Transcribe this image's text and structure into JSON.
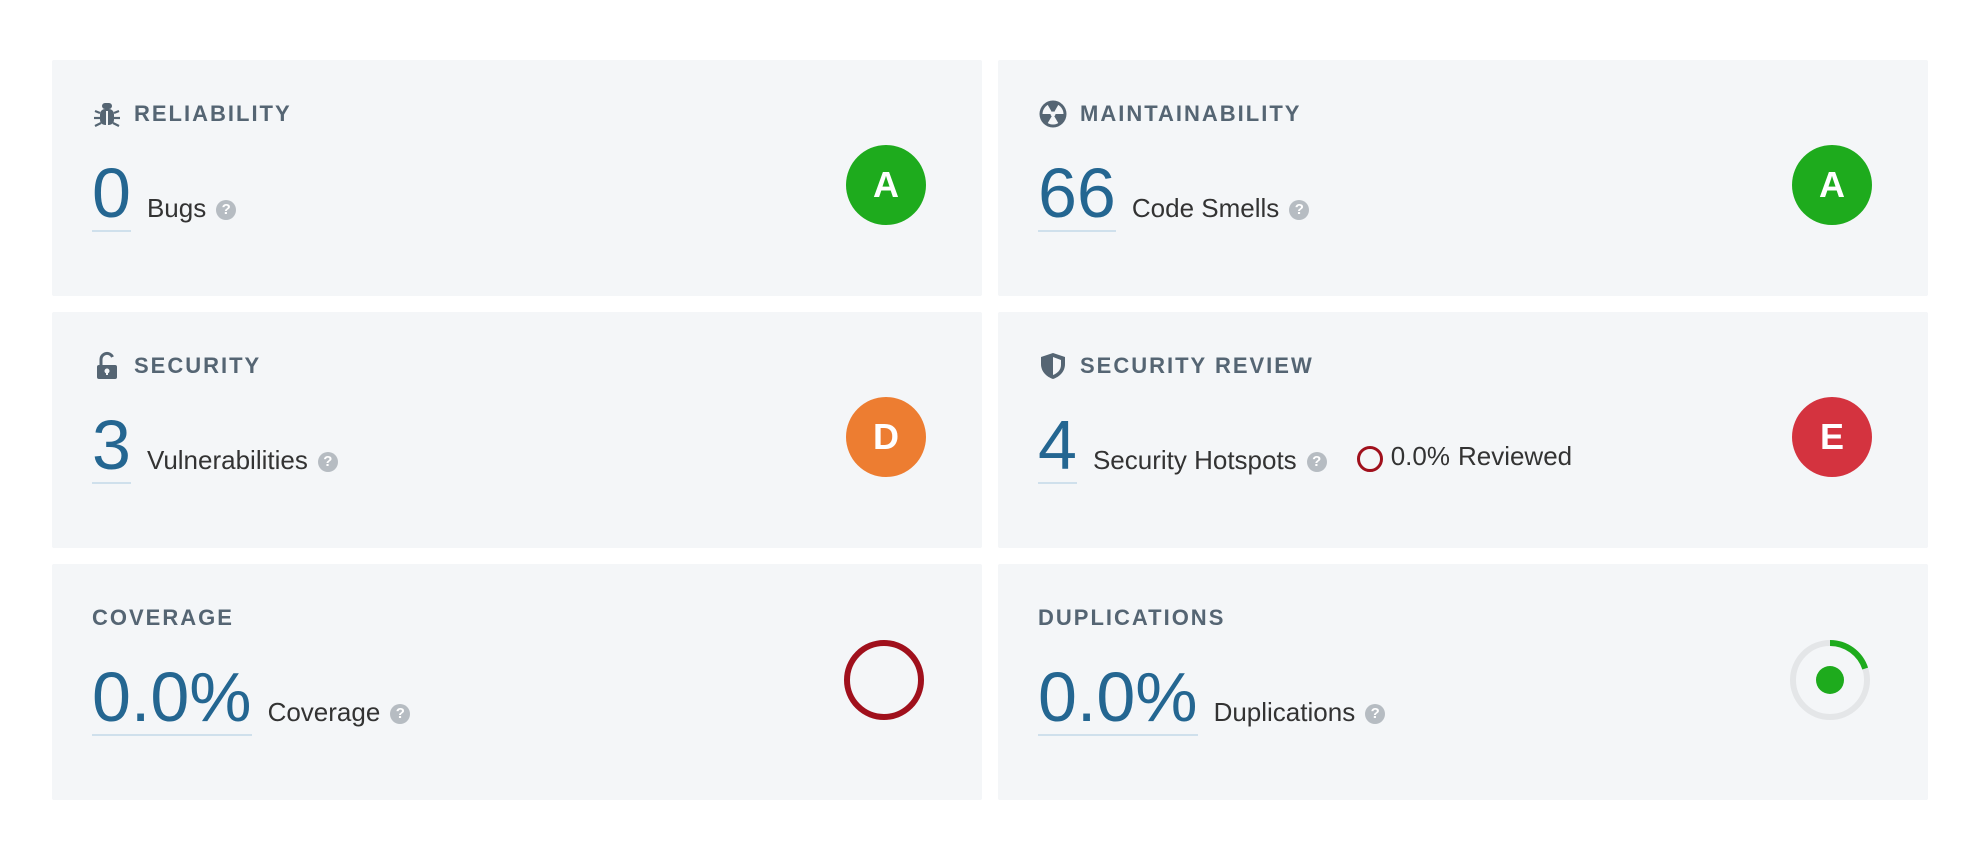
{
  "colors": {
    "rating_a": "#1eab1d",
    "rating_d": "#ed7d31",
    "rating_e": "#d4333f",
    "metric_value": "#246691",
    "coverage_ring": "#a0101c",
    "duplications_arc": "#1eab1d",
    "card_bg": "#f4f6f8"
  },
  "reliability": {
    "title": "RELIABILITY",
    "icon": "bug-icon",
    "value": "0",
    "label": "Bugs",
    "rating": "A"
  },
  "maintainability": {
    "title": "MAINTAINABILITY",
    "icon": "code-smell-icon",
    "value": "66",
    "label": "Code Smells",
    "rating": "A"
  },
  "security": {
    "title": "SECURITY",
    "icon": "unlocked-padlock-icon",
    "value": "3",
    "label": "Vulnerabilities",
    "rating": "D"
  },
  "security_review": {
    "title": "SECURITY REVIEW",
    "icon": "shield-icon",
    "value": "4",
    "label": "Security Hotspots",
    "reviewed_percent": "0.0%",
    "reviewed_label": "Reviewed",
    "rating": "E"
  },
  "coverage": {
    "title": "COVERAGE",
    "value": "0.0%",
    "label": "Coverage",
    "gauge_percent": 0
  },
  "duplications": {
    "title": "DUPLICATIONS",
    "value": "0.0%",
    "label": "Duplications",
    "gauge_percent": 0
  },
  "help_glyph": "?"
}
